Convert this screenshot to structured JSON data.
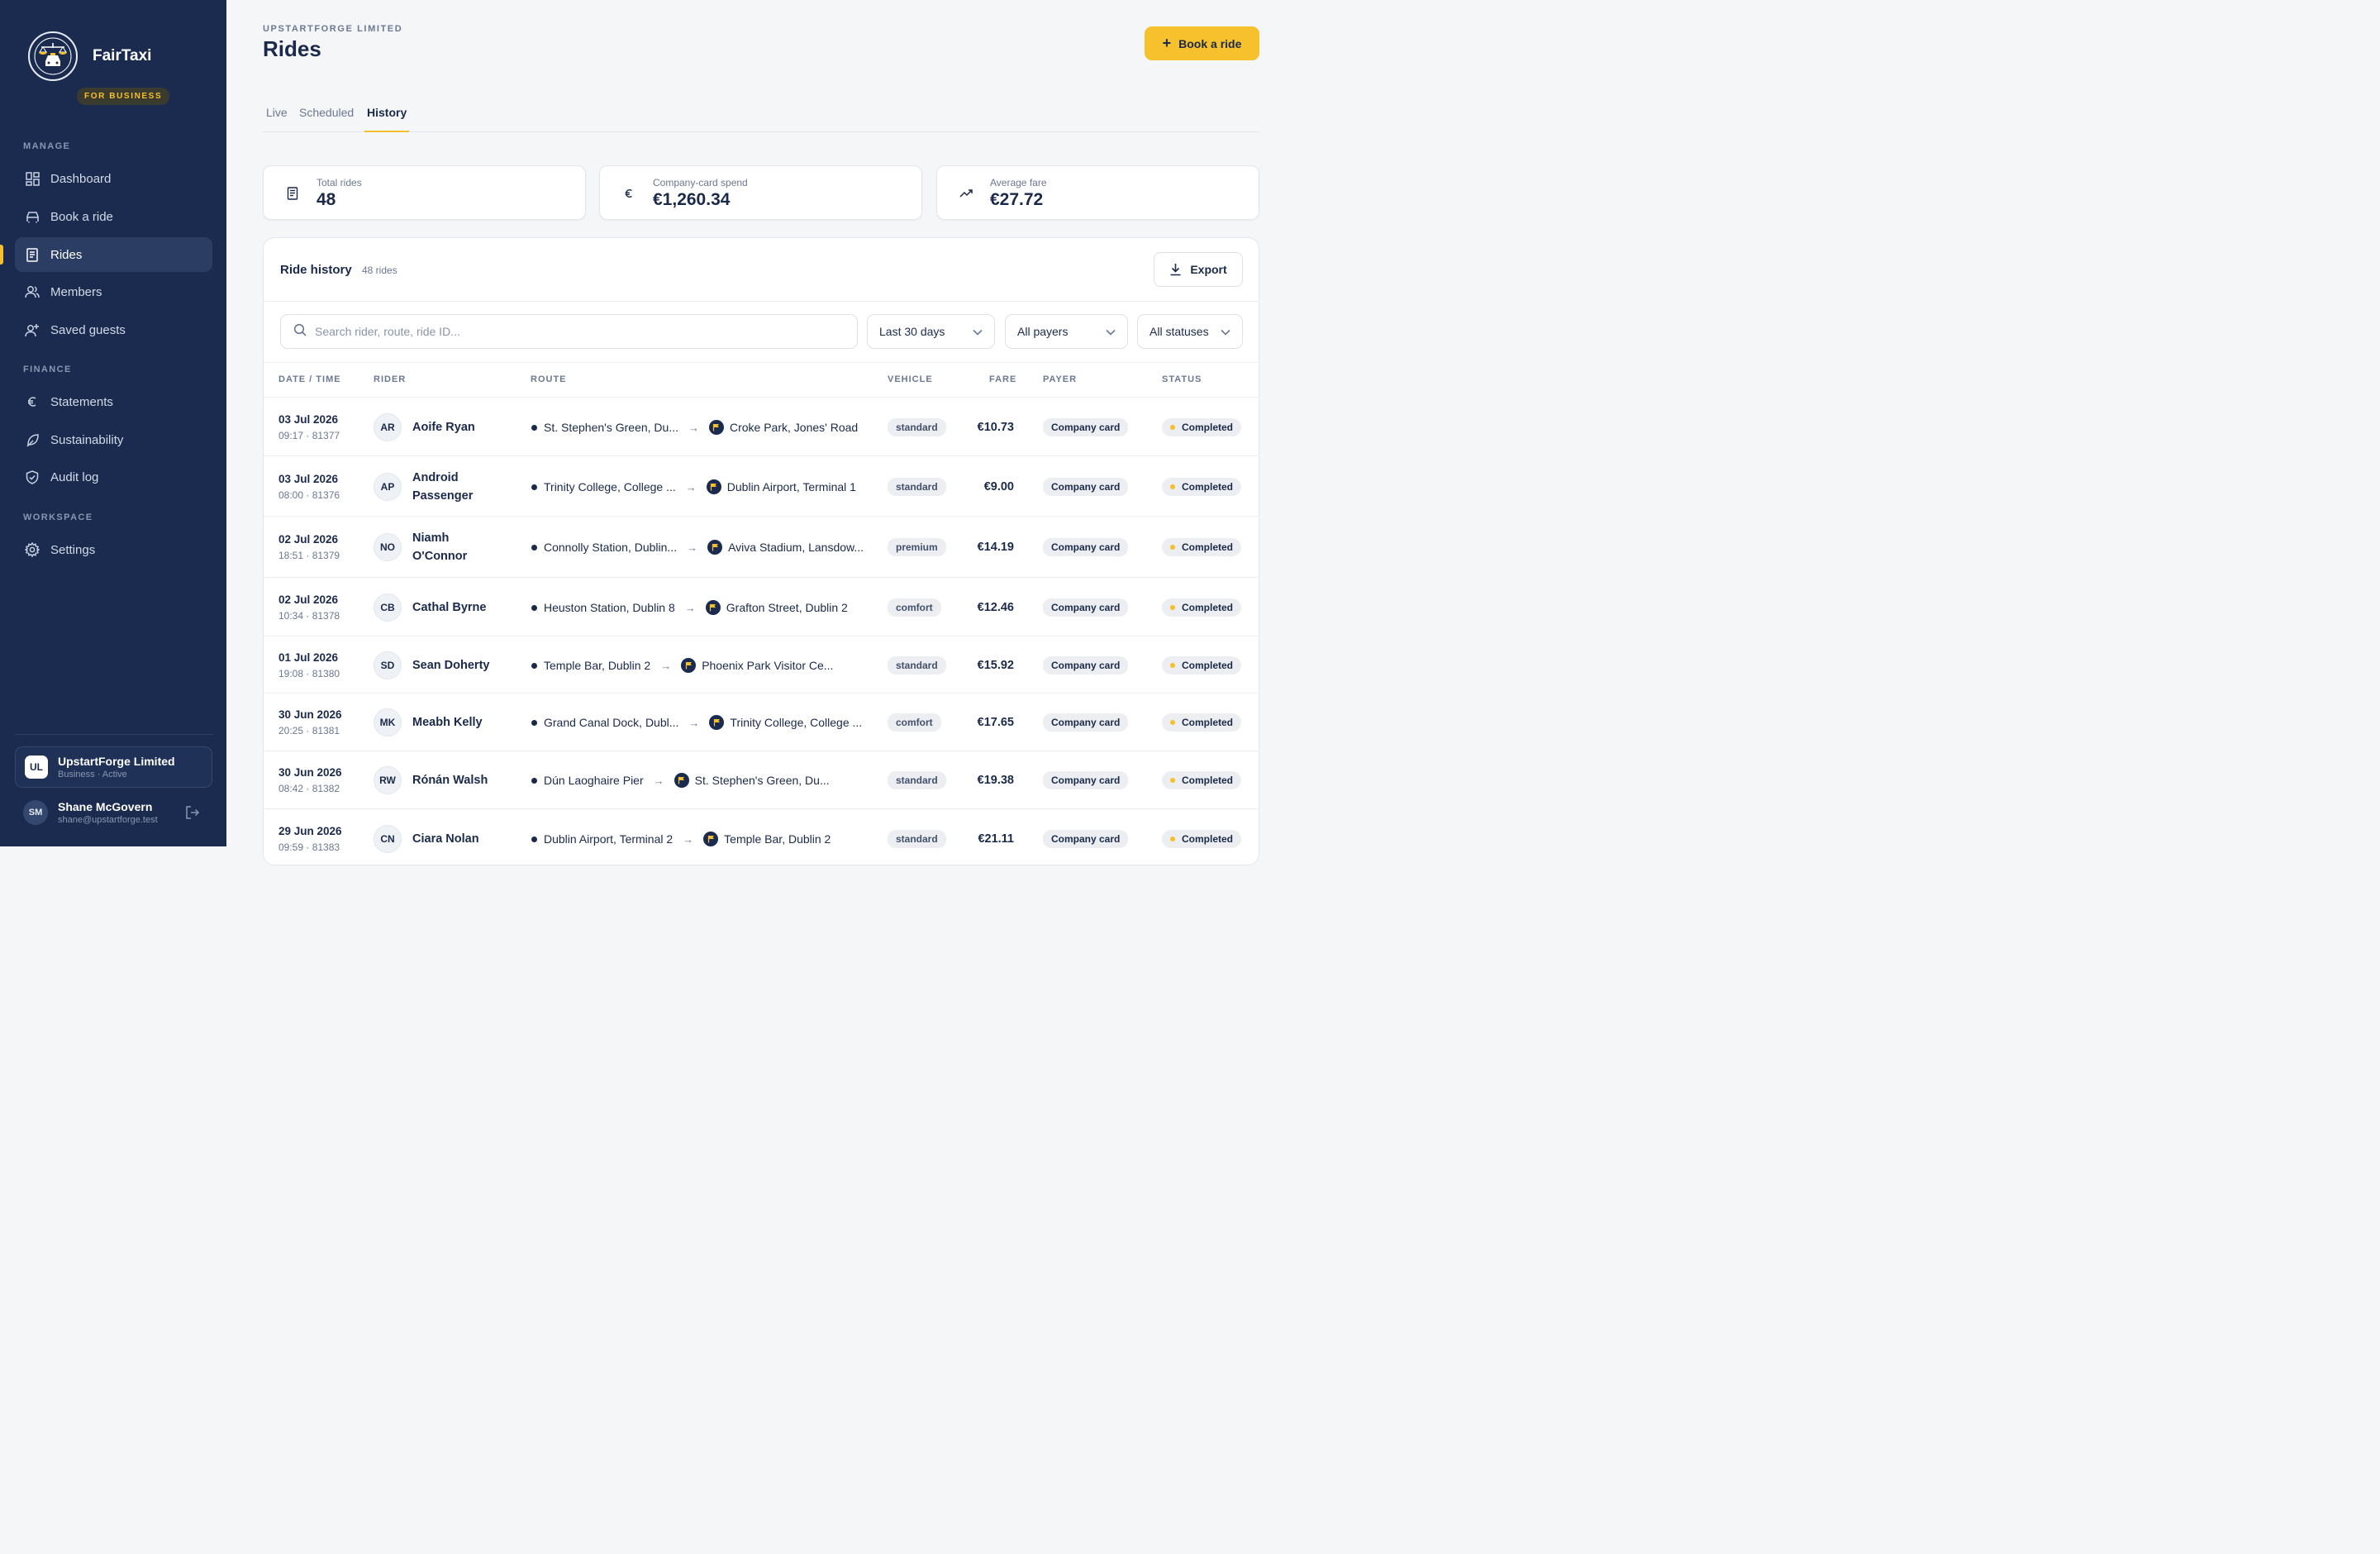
{
  "sidebar": {
    "brand_name": "FairTaxi",
    "brand_badge": "FOR BUSINESS",
    "sections": {
      "manage": "MANAGE",
      "finance": "FINANCE",
      "workspace": "WORKSPACE"
    },
    "items": {
      "dashboard": "Dashboard",
      "book": "Book a ride",
      "rides": "Rides",
      "members": "Members",
      "guests": "Saved guests",
      "statements": "Statements",
      "sustainability": "Sustainability",
      "audit": "Audit log",
      "settings": "Settings"
    },
    "org": {
      "initials": "UL",
      "name": "UpstartForge Limited",
      "sub": "Business · Active"
    },
    "user": {
      "initials": "SM",
      "name": "Shane McGovern",
      "email": "shane@upstartforge.test"
    }
  },
  "header": {
    "org_label": "UPSTARTFORGE LIMITED",
    "title": "Rides",
    "book_button": "Book a ride"
  },
  "tabs": {
    "live": "Live",
    "scheduled": "Scheduled",
    "history": "History"
  },
  "stats": {
    "total": {
      "label": "Total rides",
      "value": "48"
    },
    "spend": {
      "label": "Company-card spend",
      "value": "€1,260.34"
    },
    "average": {
      "label": "Average fare",
      "value": "€27.72"
    }
  },
  "panel": {
    "title": "Ride history",
    "count": "48 rides",
    "export": "Export",
    "search_placeholder": "Search rider, route, ride ID...",
    "filters": {
      "period": "Last 30 days",
      "payer": "All payers",
      "status": "All statuses"
    },
    "columns": {
      "date": "DATE / TIME",
      "rider": "RIDER",
      "route": "ROUTE",
      "vehicle": "VEHICLE",
      "fare": "FARE",
      "payer": "PAYER",
      "status": "STATUS"
    },
    "rows": [
      {
        "date": "03 Jul 2026",
        "time": "09:17 · 81377",
        "initials": "AR",
        "rider": "Aoife Ryan",
        "from": "St. Stephen's Green, Du...",
        "to": "Croke Park, Jones' Road",
        "vehicle": "standard",
        "fare": "€10.73",
        "payer": "Company card",
        "status": "Completed"
      },
      {
        "date": "03 Jul 2026",
        "time": "08:00 · 81376",
        "initials": "AP",
        "rider": "Android Passenger",
        "from": "Trinity College, College ...",
        "to": "Dublin Airport, Terminal 1",
        "vehicle": "standard",
        "fare": "€9.00",
        "payer": "Company card",
        "status": "Completed"
      },
      {
        "date": "02 Jul 2026",
        "time": "18:51 · 81379",
        "initials": "NO",
        "rider": "Niamh O'Connor",
        "from": "Connolly Station, Dublin...",
        "to": "Aviva Stadium, Lansdow...",
        "vehicle": "premium",
        "fare": "€14.19",
        "payer": "Company card",
        "status": "Completed"
      },
      {
        "date": "02 Jul 2026",
        "time": "10:34 · 81378",
        "initials": "CB",
        "rider": "Cathal Byrne",
        "from": "Heuston Station, Dublin 8",
        "to": "Grafton Street, Dublin 2",
        "vehicle": "comfort",
        "fare": "€12.46",
        "payer": "Company card",
        "status": "Completed"
      },
      {
        "date": "01 Jul 2026",
        "time": "19:08 · 81380",
        "initials": "SD",
        "rider": "Sean Doherty",
        "from": "Temple Bar, Dublin 2",
        "to": "Phoenix Park Visitor Ce...",
        "vehicle": "standard",
        "fare": "€15.92",
        "payer": "Company card",
        "status": "Completed"
      },
      {
        "date": "30 Jun 2026",
        "time": "20:25 · 81381",
        "initials": "MK",
        "rider": "Meabh Kelly",
        "from": "Grand Canal Dock, Dubl...",
        "to": "Trinity College, College ...",
        "vehicle": "comfort",
        "fare": "€17.65",
        "payer": "Company card",
        "status": "Completed"
      },
      {
        "date": "30 Jun 2026",
        "time": "08:42 · 81382",
        "initials": "RW",
        "rider": "Rónán Walsh",
        "from": "Dún Laoghaire Pier",
        "to": "St. Stephen's Green, Du...",
        "vehicle": "standard",
        "fare": "€19.38",
        "payer": "Company card",
        "status": "Completed"
      },
      {
        "date": "29 Jun 2026",
        "time": "09:59 · 81383",
        "initials": "CN",
        "rider": "Ciara Nolan",
        "from": "Dublin Airport, Terminal 2",
        "to": "Temple Bar, Dublin 2",
        "vehicle": "standard",
        "fare": "€21.11",
        "payer": "Company card",
        "status": "Completed"
      }
    ]
  }
}
